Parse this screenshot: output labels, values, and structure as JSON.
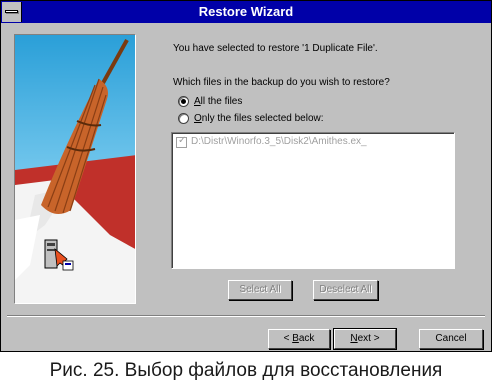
{
  "window": {
    "title": "Restore Wizard"
  },
  "content": {
    "intro": "You have selected to restore '1 Duplicate File'.",
    "question": "Which files in the backup do you wish to restore?",
    "options": [
      {
        "mnemonic": "A",
        "rest": "ll the files",
        "selected": true
      },
      {
        "mnemonic": "O",
        "rest": "nly the files selected below:",
        "selected": false
      }
    ],
    "file_list": [
      {
        "path": "D:\\Distr\\Winorfo.3_5\\Disk2\\Amithes.ex_",
        "checked": true
      }
    ],
    "list_buttons": {
      "select_all": "Select All",
      "deselect_all": "Deselect All"
    }
  },
  "footer": {
    "back": {
      "arrow": "<",
      "mnemonic": "B",
      "rest": "ack"
    },
    "next": {
      "mnemonic": "N",
      "rest": "ext",
      "arrow": ">"
    },
    "cancel": "Cancel"
  },
  "caption": "Рис. 25. Выбор файлов для восстановления",
  "colors": {
    "titlebar": "#0000a8",
    "face": "#c0c0c0",
    "broom": "#c8642a",
    "sky": "#2a9fd8"
  }
}
